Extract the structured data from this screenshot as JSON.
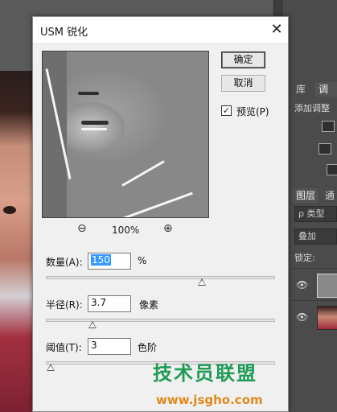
{
  "dialog": {
    "title": "USM 锐化",
    "close_label": "✕",
    "ok_label": "确定",
    "cancel_label": "取消",
    "preview_label": "预览(P)",
    "preview_checked": true,
    "zoom_level": "100%",
    "zoom_out_icon": "⊖",
    "zoom_in_icon": "⊕",
    "amount": {
      "label": "数量(A):",
      "value": "150",
      "unit": "%"
    },
    "radius": {
      "label": "半径(R):",
      "value": "3.7",
      "unit": "像素"
    },
    "threshold": {
      "label": "阈值(T):",
      "value": "3",
      "unit": "色阶"
    }
  },
  "ps_panels": {
    "tab_library": "库",
    "tab_adjust": "调",
    "adjust_hint": "添加调整",
    "tab_layers": "图层",
    "tab_channels": "通",
    "kind_filter": "ρ 类型",
    "blend_mode": "叠加",
    "lock_label": "锁定:"
  },
  "watermark": {
    "text": "技术员联盟",
    "url": "www.jsgho.com"
  },
  "colors": {
    "dialog_bg": "#f0f0f0",
    "selection": "#3399ff",
    "watermark_green": "#1e9b55",
    "watermark_orange": "#e08a1a"
  }
}
